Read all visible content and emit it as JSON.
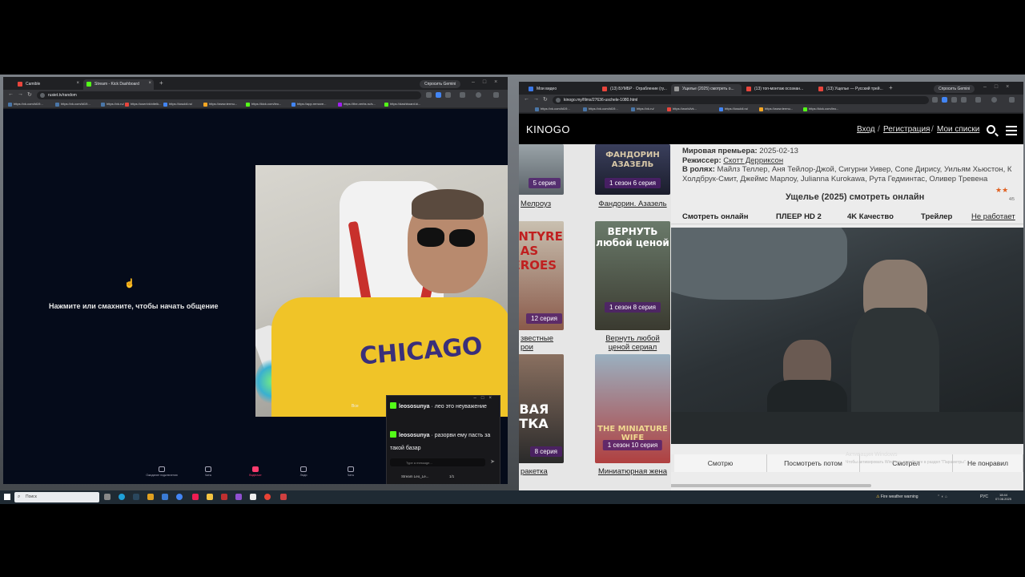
{
  "left_browser": {
    "tabs": [
      {
        "label": "Camible",
        "active": false,
        "color": "#e8453c"
      },
      {
        "label": "Stream - Kick Dashboard",
        "active": true,
        "color": "#53fc18"
      }
    ],
    "gemini_button": "Спросить Gemini",
    "url": "rusiet.tv/random",
    "bookmarks": [
      "https://vk.com/id19...",
      "https://vk.com/id19...",
      "https://vk.ru/",
      "https://user/vk/vitelk...",
      "https://iosuldi.ru/",
      "https://www.termu...",
      "https://kick.com/leo...",
      "https://app.remove...",
      "https://the-verbs.ru/s...",
      "https://dashboard.ki..."
    ],
    "page": {
      "prompt": "Нажмите или смахните, чтобы начать общение",
      "hand_icon": "pointer-hand-icon",
      "webcam_shirt_text": "CHICAGO",
      "cam_label": "Все",
      "bottom_nav": [
        "Ожидание подключения",
        "Чаты",
        "Видеочат",
        "Люди",
        "Чаты"
      ]
    },
    "chat": {
      "messages": [
        {
          "user": "leososunya",
          "text": "лео это неуважение"
        },
        {
          "user": "leososunya",
          "text": "разорви ему пасть за такой базар"
        }
      ],
      "input_placeholder": "Type a message...",
      "footer_left": "Stream Leo_Le...",
      "footer_count": "1/1"
    }
  },
  "right_browser": {
    "tabs": [
      "Мои видео",
      "(13) БУМБР · Ограбление (гу...",
      "Ущелье (2025) смотреть о...",
      "(13) топ-монтаж осознан...",
      "(13) Ущелье — Русский трей..."
    ],
    "gemini_button": "Спросить Gemini",
    "url": "kinogo.my/films/27636-uschele-1080.html",
    "bookmarks": [
      "https://vk.com/id19...",
      "https://vk.com/id19...",
      "https://vk.ru/",
      "https://world/vk...",
      "https://iosuldi.ru/",
      "https://www.termu...",
      "https://kick.com/leo..."
    ],
    "header": {
      "logo": "KINOGO",
      "login": "Вход",
      "register": "Регистрация",
      "my_lists": "Мои списки",
      "separator": "/"
    },
    "posters": [
      {
        "title": "",
        "badge": "5 серия",
        "caption": "Мелроуз",
        "colors": [
          "#9aa3a8",
          "#5b6268"
        ]
      },
      {
        "title": "ФАНДОРИН АЗАЗЕЛЬ",
        "badge": "1 сезон 6 серия",
        "caption": "Фандорин. Азазель",
        "colors": [
          "#3a3f5c",
          "#1b1d2c"
        ]
      },
      {
        "title": "ACINTYRE AS HEROES",
        "badge": "12 серия",
        "caption": "звестные рои",
        "colors": [
          "#c9c0b0",
          "#8a5a4a"
        ]
      },
      {
        "title": "ВЕРНУТЬ любой ценой",
        "badge": "1 сезон 8 серия",
        "caption": "Вернуть любой ценой сериал",
        "colors": [
          "#6a7a6a",
          "#3a3a30"
        ]
      },
      {
        "title": "РВАЯ ЕТКА",
        "badge": "8 серия",
        "caption": "ракетка",
        "colors": [
          "#8a7060",
          "#2a2a2a"
        ]
      },
      {
        "title": "THE MINIATURE WIFE",
        "badge": "1 сезон 10 серия",
        "caption": "Миниатюрная жена",
        "colors": [
          "#9ab0c0",
          "#b04040"
        ]
      }
    ],
    "film_info": {
      "premiere_label": "Мировая премьера:",
      "premiere_value": "2025-02-13",
      "director_label": "Режиссер:",
      "director_value": "Скотт Дерриксон",
      "cast_label": "В ролях:",
      "cast_line1": "Майлз Теллер, Аня Тейлор-Джой, Сигурни Уивер, Сопе Дирису, Уильям Хьюстон, К",
      "cast_line2": "Холдбрук-Смит, Джеймс Марлоу, Julianna Kurokawa, Рута Гедминтас, Оливер Тревена",
      "watch_title": "Ущелье (2025) смотреть онлайн",
      "rating": "4/5"
    },
    "player_tabs": [
      "Смотреть онлайн",
      "ПЛЕЕР HD 2",
      "4K Качество",
      "Трейлер",
      "Не работает"
    ],
    "vote_buttons": [
      "Смотрю",
      "Посмотреть потом",
      "Смотрел",
      "Не понравил"
    ],
    "windows_watermark": {
      "line1": "Активация Windows",
      "line2": "Чтобы активировать Windows, перейдите в раздел \"Параметры\"."
    }
  },
  "taskbar": {
    "search_placeholder": "Поиск",
    "weather": "Fire weather warning",
    "lang": "РУС",
    "time": "18:44",
    "date": "07.08.2025"
  }
}
